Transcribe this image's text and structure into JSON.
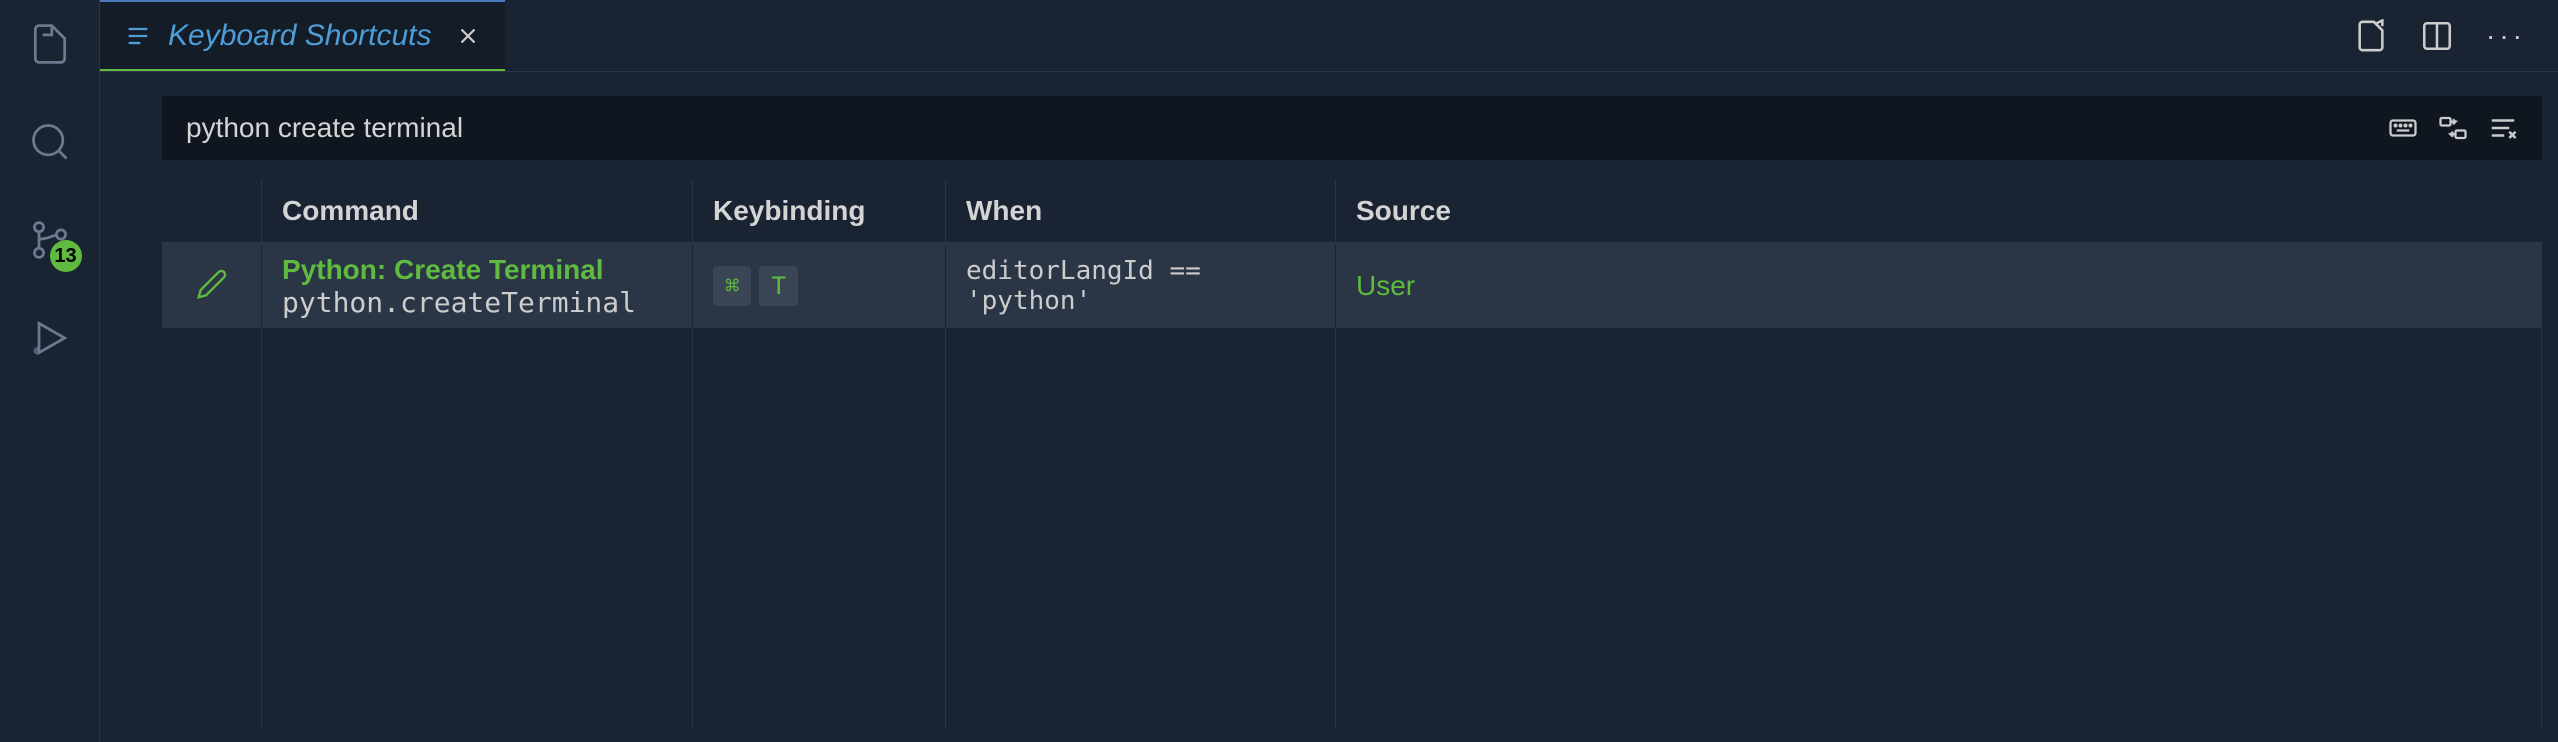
{
  "activitybar": {
    "sourceControlBadge": "13"
  },
  "tab": {
    "label": "Keyboard Shortcuts"
  },
  "search": {
    "value": "python create terminal"
  },
  "table": {
    "headers": {
      "command": "Command",
      "keybinding": "Keybinding",
      "when": "When",
      "source": "Source"
    },
    "rows": [
      {
        "commandTitle": "Python: Create Terminal",
        "commandId": "python.createTerminal",
        "keys": [
          "⌘",
          "T"
        ],
        "when": "editorLangId == 'python'",
        "source": "User"
      }
    ]
  }
}
